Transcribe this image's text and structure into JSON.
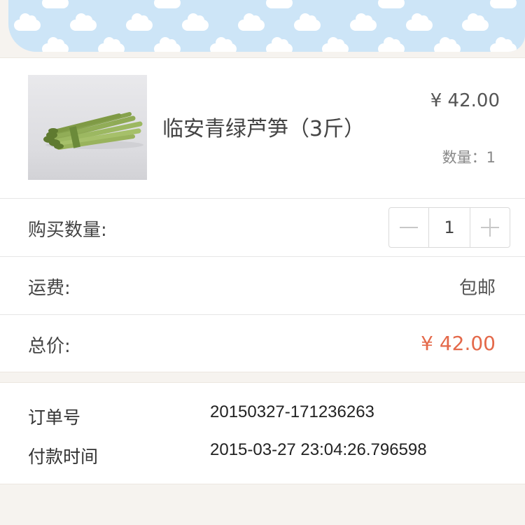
{
  "product": {
    "name": "临安青绿芦笋（3斤）",
    "price": "¥ 42.00",
    "quantity_text": "数量：1"
  },
  "purchase_quantity": {
    "label": "购买数量:",
    "value": "1"
  },
  "shipping": {
    "label": "运费:",
    "value": "包邮"
  },
  "total": {
    "label": "总价:",
    "value": "¥ 42.00"
  },
  "order": {
    "number_label": "订单号",
    "number_value": "20150327-171236263",
    "payment_time_label": "付款时间",
    "payment_time_value": "2015-03-27 23:04:26.796598"
  },
  "colors": {
    "banner_sky": "#cde5f7",
    "total_price": "#e4694a",
    "background": "#f6f3ef"
  },
  "icons": {
    "decrement": "minus-icon",
    "increment": "plus-icon"
  }
}
